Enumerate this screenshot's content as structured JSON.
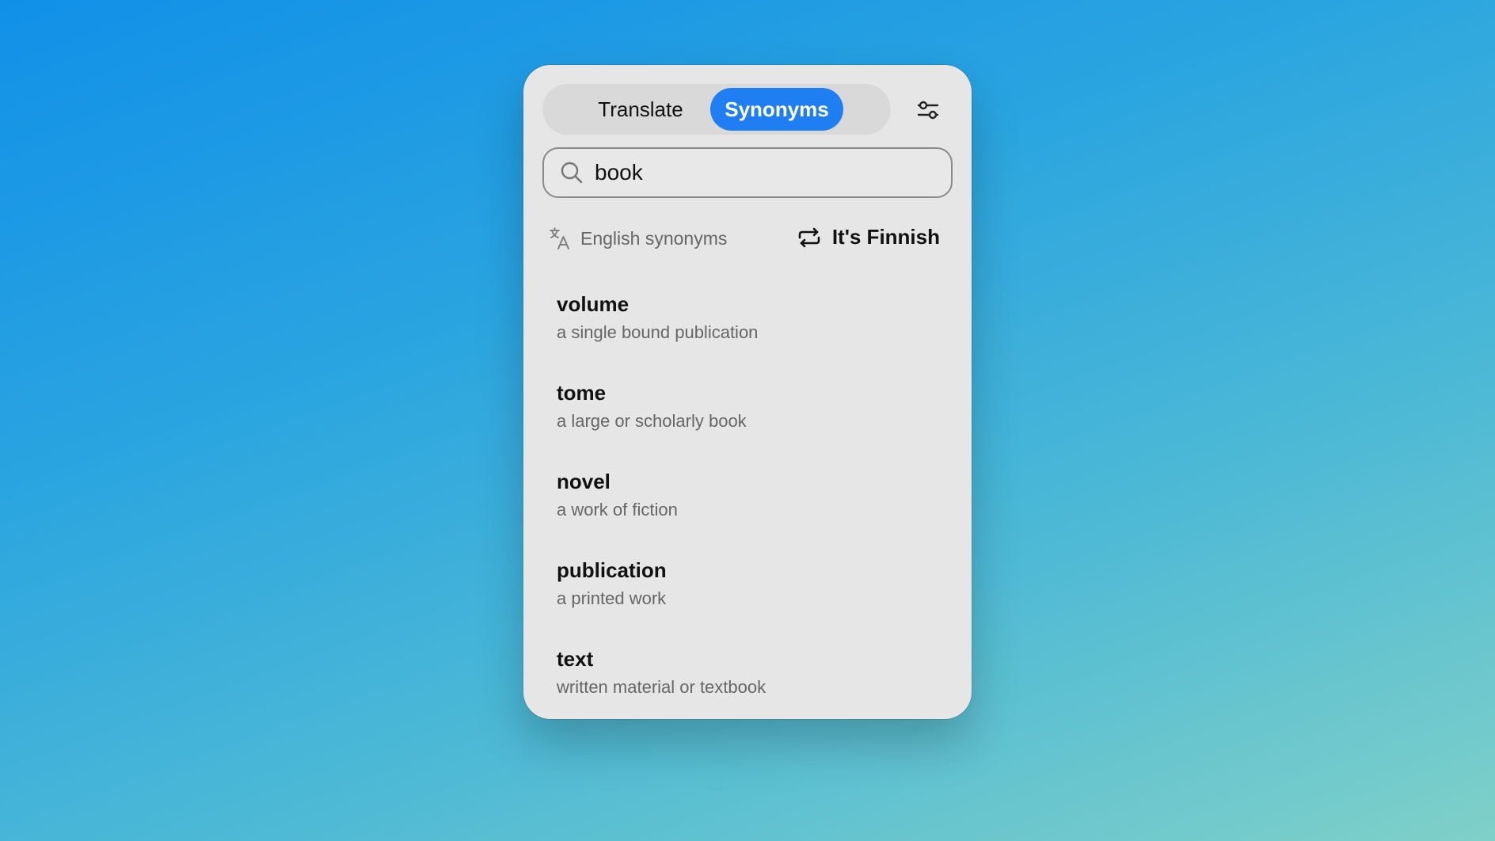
{
  "tabs": {
    "translate_label": "Translate",
    "synonyms_label": "Synonyms",
    "active": "Synonyms"
  },
  "search": {
    "value": "book"
  },
  "language": {
    "label": "English synonyms",
    "switch_label": "It's Finnish"
  },
  "results": [
    {
      "word": "volume",
      "definition": "a single bound publication"
    },
    {
      "word": "tome",
      "definition": "a large or scholarly book"
    },
    {
      "word": "novel",
      "definition": "a work of fiction"
    },
    {
      "word": "publication",
      "definition": "a printed work"
    },
    {
      "word": "text",
      "definition": "written material or textbook"
    }
  ],
  "colors": {
    "accent": "#1f7ff2",
    "panel_bg": "#e6e6e6"
  },
  "icons": {
    "settings": "sliders-icon",
    "search": "search-icon",
    "language": "translate-icon",
    "switch": "repeat-icon"
  }
}
